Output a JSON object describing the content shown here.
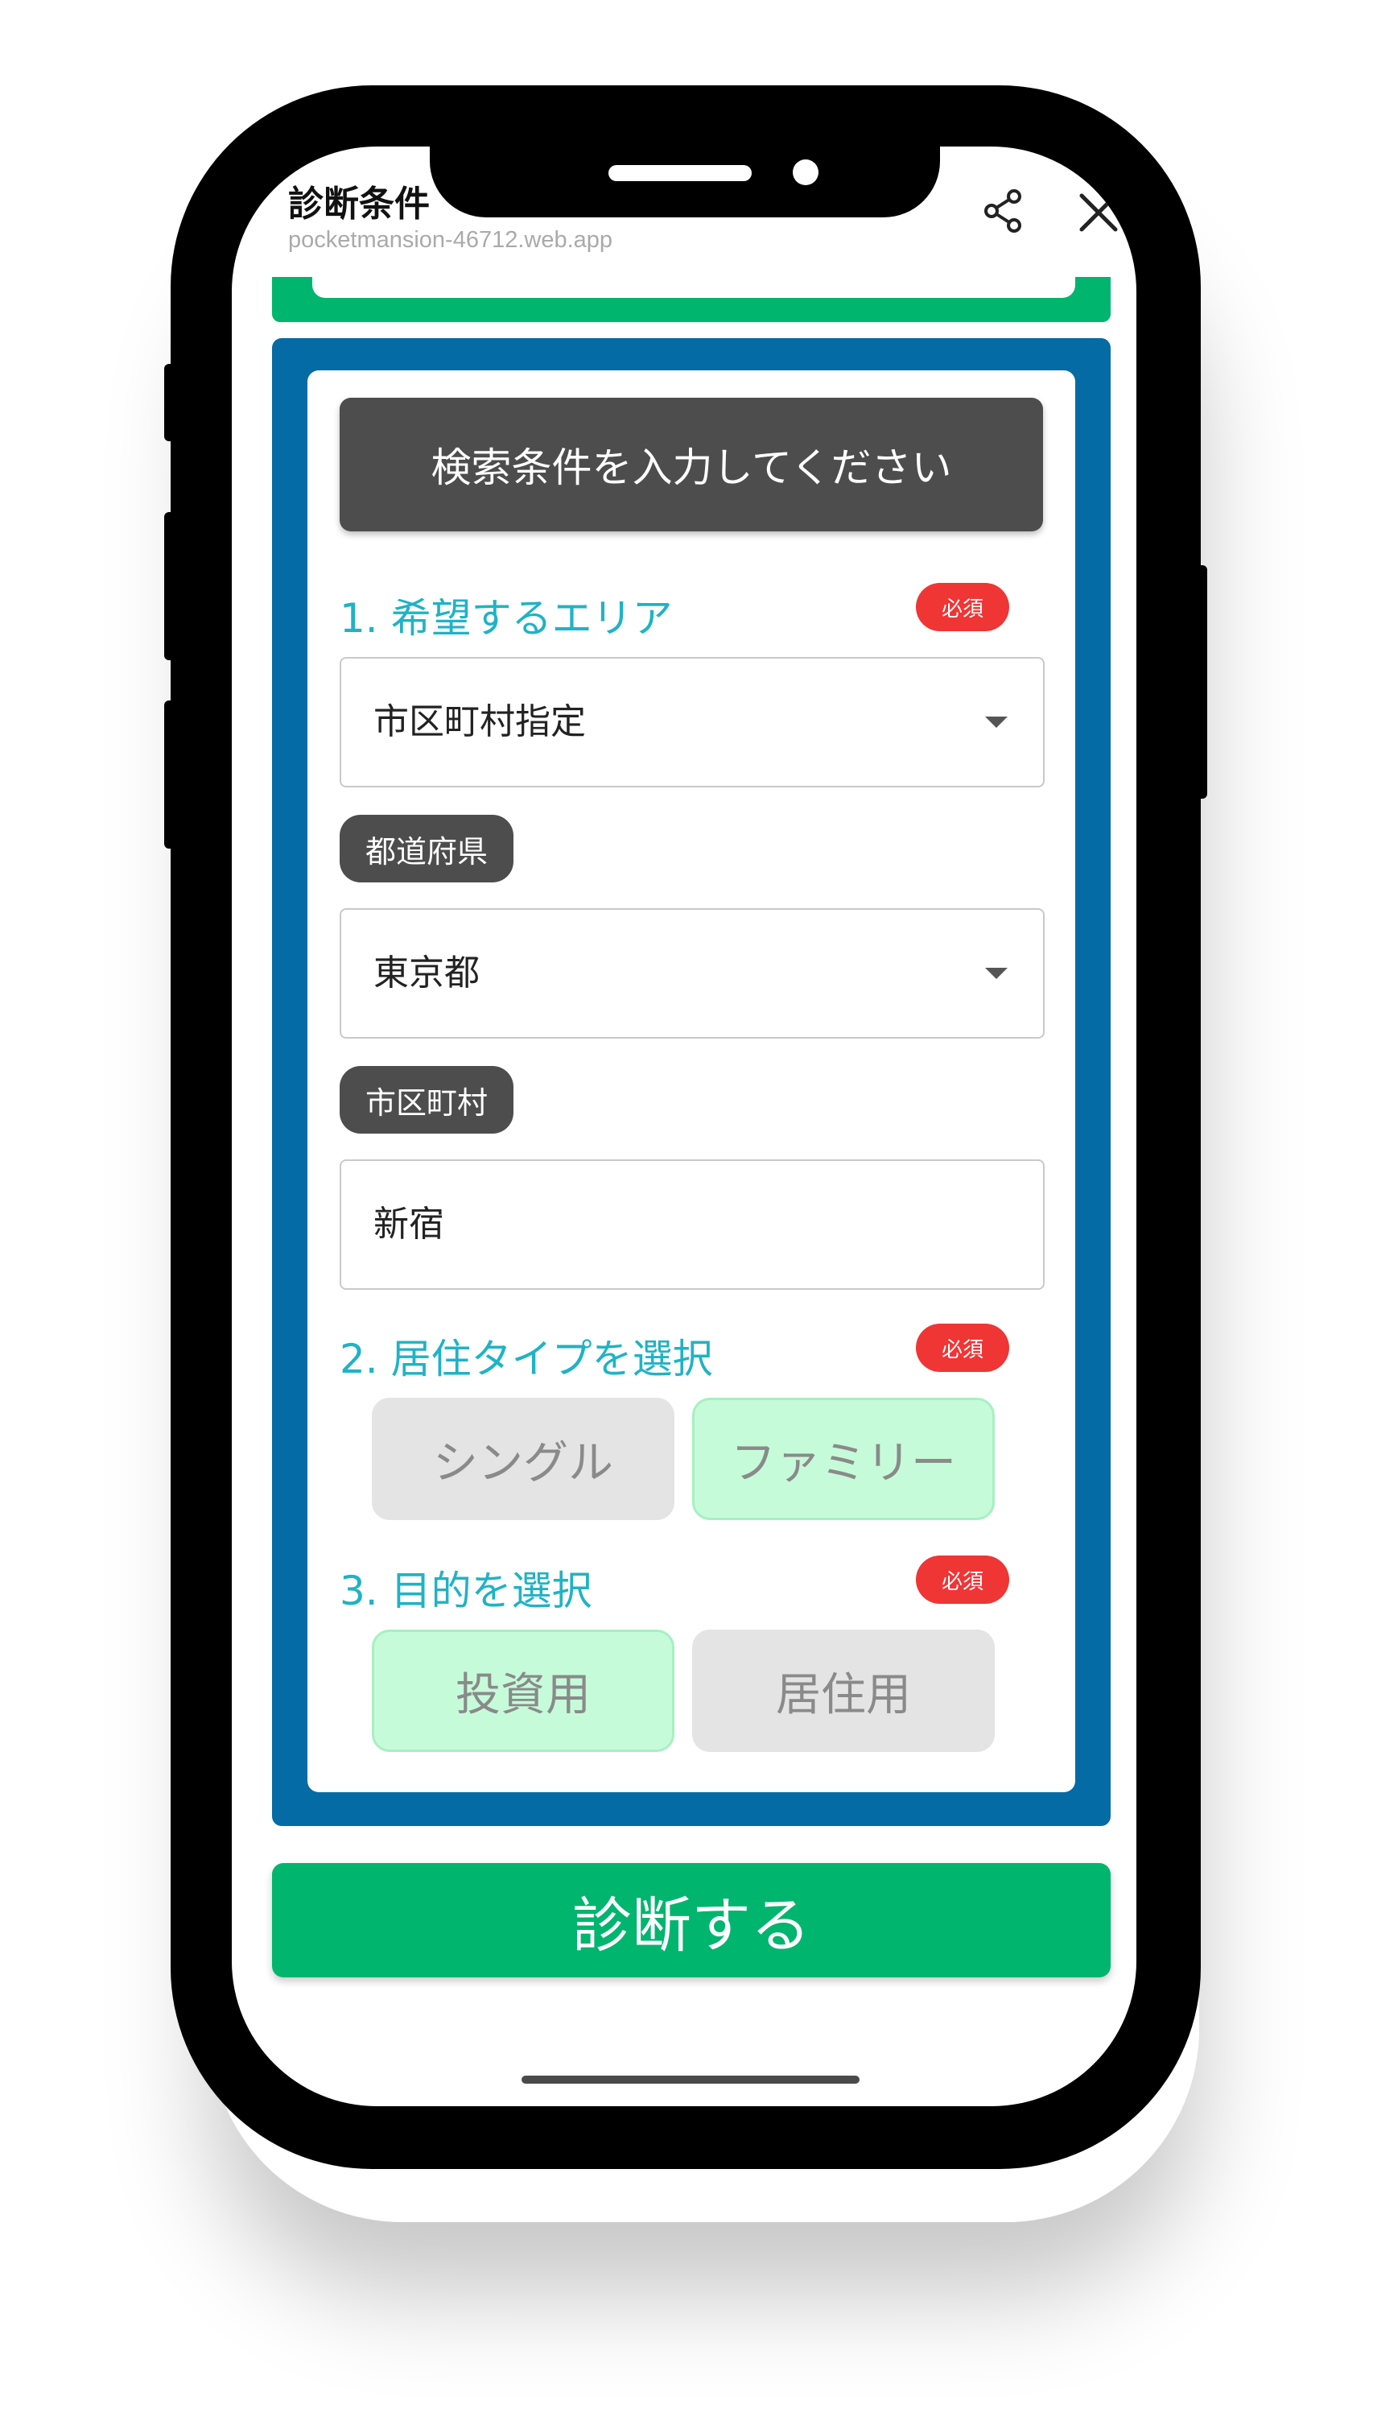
{
  "header": {
    "title": "診断条件",
    "url": "pocketmansion-46712.web.app"
  },
  "form": {
    "banner": "検索条件を入力してください",
    "required_badge": "必須",
    "area": {
      "title": "1. 希望するエリア",
      "mode_value": "市区町村指定",
      "prefecture_label": "都道府県",
      "prefecture_value": "東京都",
      "city_label": "市区町村",
      "city_value": "新宿"
    },
    "residence": {
      "title": "2. 居住タイプを選択",
      "options": [
        "シングル",
        "ファミリー"
      ],
      "selected": "ファミリー"
    },
    "purpose": {
      "title": "3. 目的を選択",
      "options": [
        "投資用",
        "居住用"
      ],
      "selected": "投資用"
    }
  },
  "submit_label": "診断する",
  "colors": {
    "accent_green": "#00b56e",
    "panel_blue": "#046ba4",
    "title_teal": "#1fb3c5",
    "required_red": "#f03535",
    "selected_mint": "#c6fbd9"
  }
}
